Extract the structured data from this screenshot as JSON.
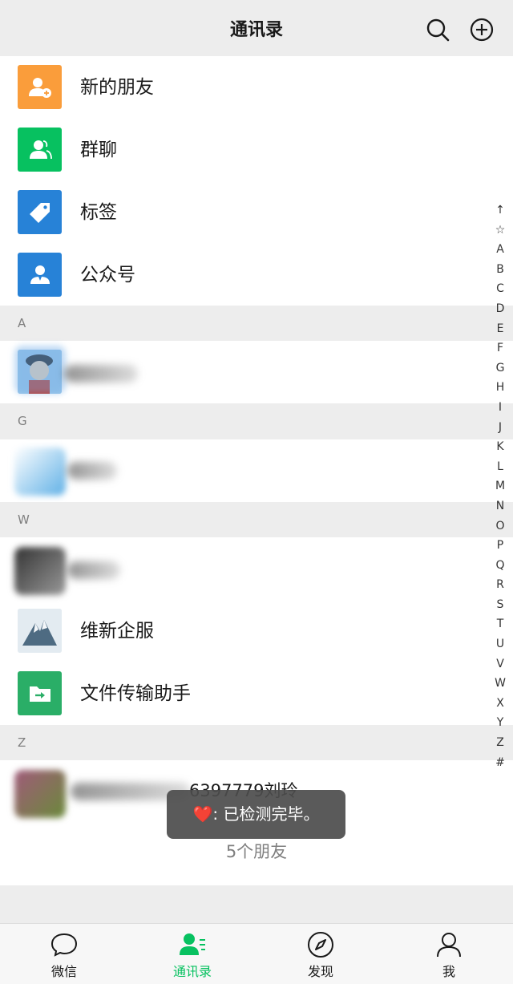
{
  "header": {
    "title": "通讯录"
  },
  "top_items": [
    {
      "label": "新的朋友",
      "color": "#fa9d3b",
      "icon": "add-friend-icon"
    },
    {
      "label": "群聊",
      "color": "#07c160",
      "icon": "group-chat-icon"
    },
    {
      "label": "标签",
      "color": "#2782d7",
      "icon": "tag-icon"
    },
    {
      "label": "公众号",
      "color": "#2782d7",
      "icon": "official-account-icon"
    }
  ],
  "sections": {
    "a": "A",
    "g": "G",
    "w": "W",
    "z": "Z"
  },
  "contacts": {
    "weixin_service": "维新企服",
    "file_transfer": "文件传输助手",
    "z_contact_suffix": "6397779刘玲"
  },
  "index_letters": [
    "↑",
    "☆",
    "A",
    "B",
    "C",
    "D",
    "E",
    "F",
    "G",
    "H",
    "I",
    "J",
    "K",
    "L",
    "M",
    "N",
    "O",
    "P",
    "Q",
    "R",
    "S",
    "T",
    "U",
    "V",
    "W",
    "X",
    "Y",
    "Z",
    "#"
  ],
  "toast": {
    "emoji": "❤️",
    "text": ": 已检测完毕。"
  },
  "friend_count": "5个朋友",
  "tabs": [
    {
      "label": "微信",
      "icon": "chat-icon"
    },
    {
      "label": "通讯录",
      "icon": "contacts-icon"
    },
    {
      "label": "发现",
      "icon": "compass-icon"
    },
    {
      "label": "我",
      "icon": "me-icon"
    }
  ],
  "colors": {
    "accent": "#07c160",
    "file_transfer": "#2aae67"
  }
}
